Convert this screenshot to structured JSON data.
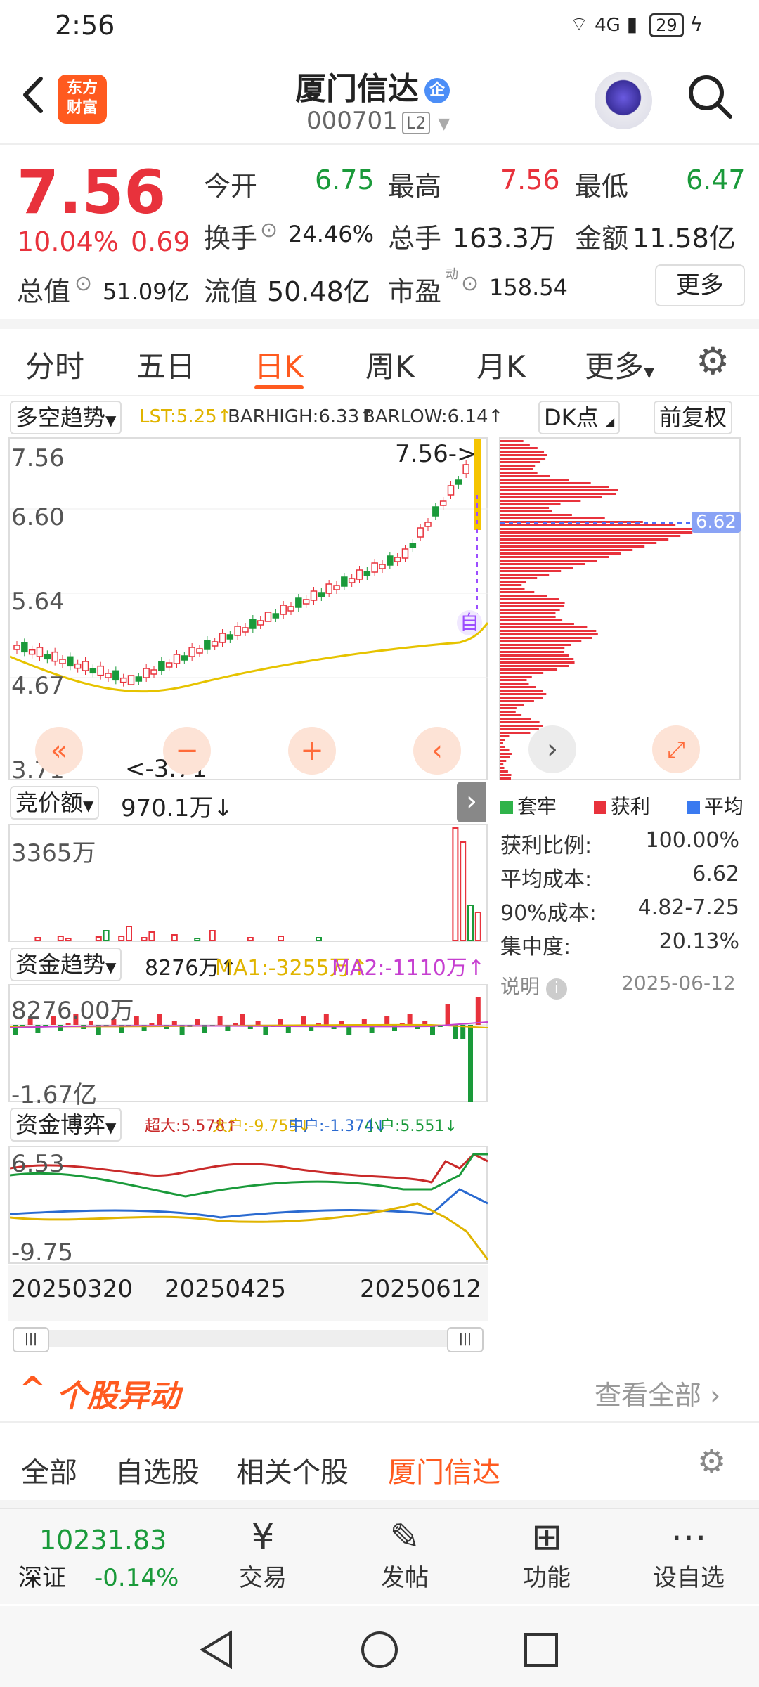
{
  "status": {
    "time": "2:56",
    "network": "4G",
    "battery": "29"
  },
  "header": {
    "logo_text_line1": "东方",
    "logo_text_line2": "财富",
    "stock_name": "厦门信达",
    "badge": "企",
    "stock_code": "000701",
    "level": "L2"
  },
  "quote": {
    "price": "7.56",
    "pct": "10.04%",
    "change": "0.69",
    "open_label": "今开",
    "open": "6.75",
    "high_label": "最高",
    "high": "7.56",
    "low_label": "最低",
    "low": "6.47",
    "turnover_label": "换手",
    "turnover": "24.46%",
    "volume_label": "总手",
    "volume": "163.3万",
    "amount_label": "金额",
    "amount": "11.58亿",
    "mcap_label": "总值",
    "mcap": "51.09亿",
    "float_label": "流值",
    "float": "50.48亿",
    "pe_label": "市盈",
    "pe_sup": "动",
    "pe": "158.54",
    "more": "更多"
  },
  "tabs": [
    "分时",
    "五日",
    "日K",
    "周K",
    "月K",
    "更多"
  ],
  "active_tab": "日K",
  "kline": {
    "indicator": "多空趋势",
    "lst": "LST:5.25↑",
    "barhigh": "BARHIGH:6.33↑",
    "barlow": "BARLOW:6.14↑",
    "dk": "DK点",
    "fuquan": "前复权",
    "y_top": "7.56",
    "y_2": "6.60",
    "y_3": "5.64",
    "y_4": "4.67",
    "y_bottom": "3.71",
    "high_mark": "7.56->",
    "low_mark": "<-3.71",
    "auto": "自"
  },
  "chip": {
    "price_mark": "6.62",
    "legend": [
      "套牢",
      "获利",
      "平均"
    ],
    "rows": [
      {
        "label": "获利比例:",
        "value": "100.00%"
      },
      {
        "label": "平均成本:",
        "value": "6.62"
      },
      {
        "label": "90%成本:",
        "value": "4.82-7.25"
      },
      {
        "label": "集中度:",
        "value": "20.13%"
      }
    ],
    "note": "说明",
    "date": "2025-06-12"
  },
  "auction": {
    "label": "竞价额",
    "value": "970.1万↓",
    "y_top": "3365万"
  },
  "fund": {
    "label": "资金趋势",
    "v": "8276万↑",
    "ma1": "MA1:-3255万↑",
    "ma2": "MA2:-1110万↑",
    "y_top": "8276.00万",
    "y_bottom": "-1.67亿"
  },
  "game": {
    "label": "资金博弈",
    "chao": "超大:5.578↑",
    "da": "大户:-9.755↓",
    "zhong": "中户:-1.374↓",
    "xiao": "小户:5.551↓",
    "y_top": "6.53",
    "y_bottom": "-9.75"
  },
  "dates": [
    "20250320",
    "20250425",
    "20250612"
  ],
  "section": {
    "title": "个股异动",
    "view_all": "查看全部"
  },
  "bottom_tabs": [
    "全部",
    "自选股",
    "相关个股",
    "厦门信达"
  ],
  "dock": {
    "index_value": "10231.83",
    "index_name": "深证",
    "index_pct": "-0.14%",
    "items": [
      "交易",
      "发帖",
      "功能",
      "设自选"
    ]
  },
  "colors": {
    "up": "#e8323c",
    "down": "#1a9a3a",
    "accent": "#ff5a1f"
  }
}
